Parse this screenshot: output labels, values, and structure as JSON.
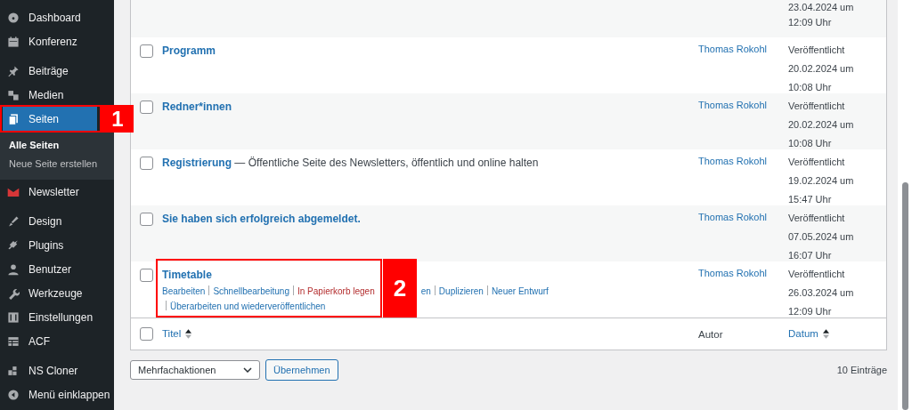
{
  "sidebar": {
    "groups": [
      {
        "items": [
          {
            "label": "Dashboard",
            "selected": false
          },
          {
            "label": "Konferenz",
            "selected": false
          }
        ]
      },
      {
        "items": [
          {
            "label": "Beiträge",
            "selected": false
          },
          {
            "label": "Medien",
            "selected": false
          },
          {
            "label": "Seiten",
            "selected": true,
            "callout": "1",
            "children": [
              {
                "label": "Alle Seiten",
                "selected": true
              },
              {
                "label": "Neue Seite erstellen",
                "selected": false
              }
            ]
          },
          {
            "label": "Newsletter",
            "selected": false
          }
        ]
      },
      {
        "items": [
          {
            "label": "Design",
            "selected": false
          },
          {
            "label": "Plugins",
            "selected": false
          },
          {
            "label": "Benutzer",
            "selected": false
          },
          {
            "label": "Werkzeuge",
            "selected": false
          },
          {
            "label": "Einstellungen",
            "selected": false
          },
          {
            "label": "ACF",
            "selected": false
          }
        ]
      },
      {
        "items": [
          {
            "label": "NS Cloner",
            "selected": false
          },
          {
            "label": "Menü einklappen",
            "selected": false
          }
        ]
      }
    ]
  },
  "table": {
    "rows": [
      {
        "date": "23.04.2024 um",
        "time": "12:09 Uhr"
      },
      {
        "checked": false,
        "title": "Programm",
        "author": "Thomas Rokohl",
        "status": "Veröffentlicht",
        "date": "20.02.2024 um",
        "time": "10:08 Uhr"
      },
      {
        "checked": false,
        "title": "Redner*innen",
        "author": "Thomas Rokohl",
        "status": "Veröffentlicht",
        "date": "20.02.2024 um",
        "time": "10:08 Uhr"
      },
      {
        "checked": false,
        "title": "Registrierung",
        "suffix": "— Öffentliche Seite des Newsletters, öffentlich und online halten",
        "author": "Thomas Rokohl",
        "status": "Veröffentlicht",
        "date": "19.02.2024 um",
        "time": "15:47 Uhr"
      },
      {
        "checked": false,
        "title": "Sie haben sich erfolgreich abgemeldet.",
        "author": "Thomas Rokohl",
        "status": "Veröffentlicht",
        "date": "07.05.2024 um",
        "time": "16:07 Uhr"
      },
      {
        "checked": false,
        "title": "Timetable",
        "callout": "2",
        "author": "Thomas Rokohl",
        "status": "Veröffentlicht",
        "date": "26.03.2024 um",
        "time": "12:09 Uhr",
        "actions": [
          {
            "label": "Bearbeiten",
            "kind": "link"
          },
          {
            "label": "Schnellbearbeitung",
            "kind": "link"
          },
          {
            "label": "In Papierkorb legen",
            "kind": "delete"
          },
          {
            "label": "en",
            "kind": "partial"
          },
          {
            "label": "Duplizieren",
            "kind": "link"
          },
          {
            "label": "Neuer Entwurf",
            "kind": "link"
          },
          {
            "label": "Überarbeiten und wiederveröffentlichen",
            "kind": "link"
          }
        ]
      }
    ],
    "footer": {
      "checked": false,
      "columns": [
        {
          "label": "Titel",
          "sortable": true
        },
        {
          "label": "Autor",
          "sortable": false
        },
        {
          "label": "Datum",
          "sortable": true
        }
      ]
    }
  },
  "bulk": {
    "select": "Mehrfachaktionen",
    "button": "Übernehmen",
    "count": "10 Einträge"
  }
}
